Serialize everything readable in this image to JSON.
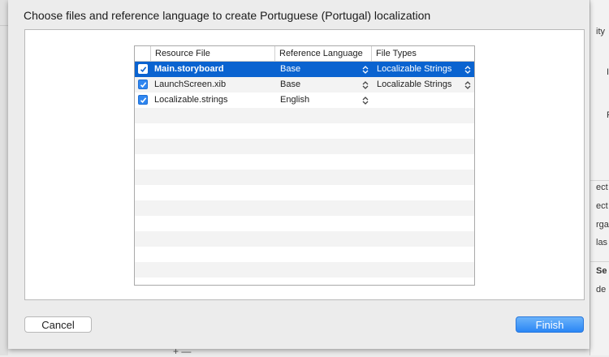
{
  "dialog": {
    "title": "Choose files and reference language to create Portuguese (Portugal) localization",
    "cancel_label": "Cancel",
    "finish_label": "Finish"
  },
  "table": {
    "columns": [
      "Resource File",
      "Reference Language",
      "File Types"
    ],
    "rows": [
      {
        "checked": true,
        "file": "Main.storyboard",
        "language": "Base",
        "type": "Localizable Strings",
        "selected": true
      },
      {
        "checked": true,
        "file": "LaunchScreen.xib",
        "language": "Base",
        "type": "Localizable Strings",
        "selected": false
      },
      {
        "checked": true,
        "file": "Localizable.strings",
        "language": "English",
        "type": "",
        "selected": false
      }
    ]
  },
  "background_window": {
    "fragments": [
      "ity",
      "I",
      "F",
      "ect",
      "ect",
      "rga",
      "las",
      "Se",
      "de"
    ],
    "bottom_controls": "+ —"
  },
  "colors": {
    "selection": "#0a63d0",
    "checkbox": "#2f86f0",
    "finish_button": "#2a86f5"
  }
}
